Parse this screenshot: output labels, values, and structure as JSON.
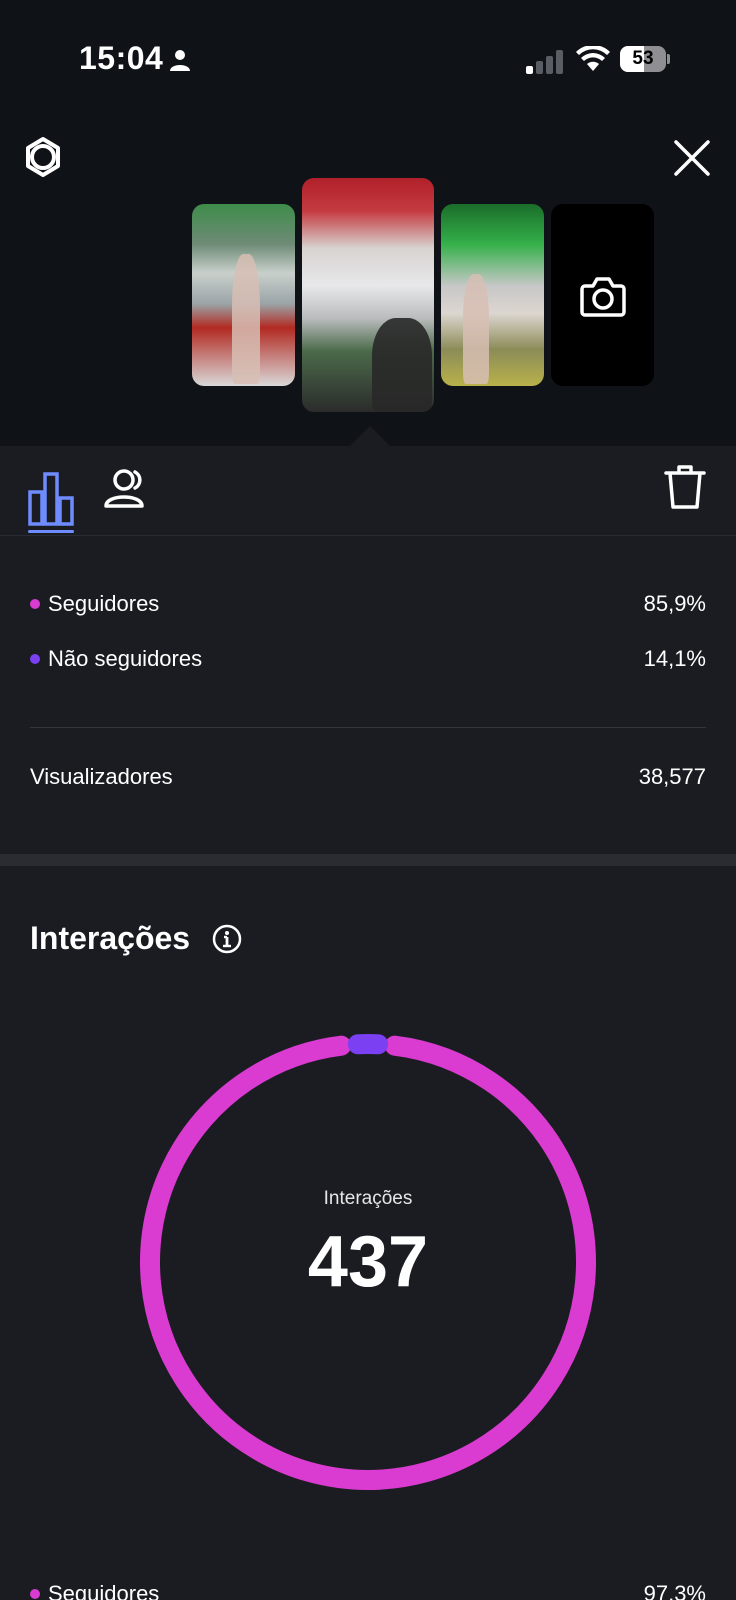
{
  "status_bar": {
    "time": "15:04",
    "battery": "53",
    "battery_level_percent": 53
  },
  "header": {
    "settings_icon": "gear-icon",
    "close_icon": "close-icon"
  },
  "stories": {
    "thumbnails": [
      "story-1",
      "story-2-selected",
      "story-3"
    ],
    "camera_icon": "camera-icon"
  },
  "tabs": {
    "insights_icon": "bar-chart-icon",
    "audience_icon": "people-icon",
    "delete_icon": "trash-icon",
    "active_color": "#6f8cff"
  },
  "audience": {
    "followers_label": "Seguidores",
    "followers_value": "85,9%",
    "non_followers_label": "Não seguidores",
    "non_followers_value": "14,1%",
    "viewers_label": "Visualizadores",
    "viewers_value": "38,577"
  },
  "interactions": {
    "title": "Interações",
    "center_label": "Interações",
    "center_value": "437",
    "followers_label": "Seguidores",
    "followers_value": "97,3%"
  },
  "colors": {
    "followers": "#da3bd1",
    "non_followers": "#7a40f2"
  },
  "chart_data": {
    "type": "pie",
    "categories": [
      "Seguidores",
      "Não seguidores"
    ],
    "values": [
      97.3,
      2.7
    ],
    "total": 437
  }
}
